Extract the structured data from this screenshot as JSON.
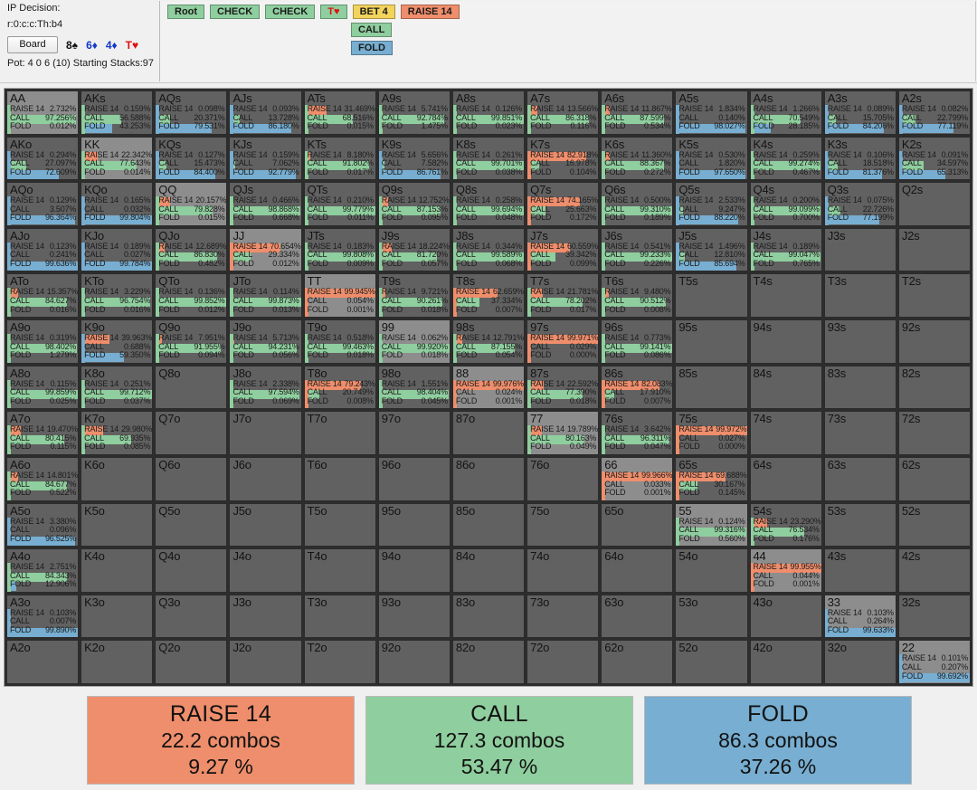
{
  "header": {
    "decision_label": "IP Decision:",
    "line_code": "r:0:c:c:Th:b4",
    "board_button": "Board",
    "board_cards": [
      {
        "text": "8♠",
        "color": "black"
      },
      {
        "text": "6♦",
        "color": "blue"
      },
      {
        "text": "4♦",
        "color": "blue"
      },
      {
        "text": "T♥",
        "color": "red"
      }
    ],
    "pot_line": "Pot: 4 0 6 (10) Starting Stacks:97",
    "tree_row1": [
      {
        "label": "Root",
        "style": "n-green"
      },
      {
        "label": "CHECK",
        "style": "n-green"
      },
      {
        "label": "CHECK",
        "style": "n-green"
      },
      {
        "label": "T♥",
        "style": "n-green",
        "red_suit": true
      },
      {
        "label": "BET 4",
        "style": "n-yellow"
      },
      {
        "label": "RAISE 14",
        "style": "n-orange"
      }
    ],
    "tree_row2": [
      {
        "label": "CALL",
        "style": "n-green"
      }
    ],
    "tree_row3": [
      {
        "label": "FOLD",
        "style": "n-blue"
      }
    ]
  },
  "colors": {
    "raise": "#ef8e6c",
    "call": "#8fce9e",
    "fold": "#77aed1",
    "cell_bg": "#616161",
    "pair_bg": "#8d8d8d"
  },
  "action_names": {
    "raise": "RAISE 14",
    "call": "CALL",
    "fold": "FOLD"
  },
  "summary": [
    {
      "title": "RAISE 14",
      "combos": "22.2 combos",
      "percent": "9.27 %",
      "style": "s-raise"
    },
    {
      "title": "CALL",
      "combos": "127.3 combos",
      "percent": "53.47 %",
      "style": "s-call"
    },
    {
      "title": "FOLD",
      "combos": "86.3 combos",
      "percent": "37.26 %",
      "style": "s-fold"
    }
  ],
  "chart_data": {
    "type": "heatmap",
    "title": "Poker hand range grid — IP decision r:0:c:c:Th:b4",
    "xlabel": "",
    "ylabel": "",
    "rows": 13,
    "cols": 13,
    "ranks": [
      "A",
      "K",
      "Q",
      "J",
      "T",
      "9",
      "8",
      "7",
      "6",
      "5",
      "4",
      "3",
      "2"
    ],
    "actions": [
      "RAISE 14",
      "CALL",
      "FOLD"
    ],
    "legend": [
      "RAISE 14 (orange)",
      "CALL (green)",
      "FOLD (blue)"
    ],
    "cells": [
      {
        "hand": "AA",
        "pair": true,
        "raise": 2.732,
        "call": 97.256,
        "fold": 0.012
      },
      {
        "hand": "AKs",
        "raise": 0.159,
        "call": 56.588,
        "fold": 43.253
      },
      {
        "hand": "AQs",
        "raise": 0.098,
        "call": 20.371,
        "fold": 79.531
      },
      {
        "hand": "AJs",
        "raise": 0.093,
        "call": 13.728,
        "fold": 86.18
      },
      {
        "hand": "ATs",
        "raise": 31.469,
        "call": 68.516,
        "fold": 0.015
      },
      {
        "hand": "A9s",
        "raise": 5.741,
        "call": 92.784,
        "fold": 1.475
      },
      {
        "hand": "A8s",
        "raise": 0.126,
        "call": 99.851,
        "fold": 0.023
      },
      {
        "hand": "A7s",
        "raise": 13.566,
        "call": 86.318,
        "fold": 0.116
      },
      {
        "hand": "A6s",
        "raise": 11.867,
        "call": 87.599,
        "fold": 0.534
      },
      {
        "hand": "A5s",
        "raise": 1.834,
        "call": 0.14,
        "fold": 98.027
      },
      {
        "hand": "A4s",
        "raise": 1.266,
        "call": 70.549,
        "fold": 28.185
      },
      {
        "hand": "A3s",
        "raise": 0.089,
        "call": 15.705,
        "fold": 84.206
      },
      {
        "hand": "A2s",
        "raise": 0.082,
        "call": 22.799,
        "fold": 77.119
      },
      {
        "hand": "AKo",
        "raise": 0.294,
        "call": 27.097,
        "fold": 72.609
      },
      {
        "hand": "KK",
        "pair": true,
        "raise": 22.342,
        "call": 77.643,
        "fold": 0.014
      },
      {
        "hand": "KQs",
        "raise": 0.127,
        "call": 15.473,
        "fold": 84.4
      },
      {
        "hand": "KJs",
        "raise": 0.159,
        "call": 7.062,
        "fold": 92.779
      },
      {
        "hand": "KTs",
        "raise": 8.18,
        "call": 91.802,
        "fold": 0.017
      },
      {
        "hand": "K9s",
        "raise": 5.656,
        "call": 7.582,
        "fold": 86.761
      },
      {
        "hand": "K8s",
        "raise": 0.261,
        "call": 99.701,
        "fold": 0.038
      },
      {
        "hand": "K7s",
        "raise": 82.918,
        "call": 16.978,
        "fold": 0.104
      },
      {
        "hand": "K6s",
        "raise": 11.36,
        "call": 88.367,
        "fold": 0.272
      },
      {
        "hand": "K5s",
        "raise": 0.53,
        "call": 1.82,
        "fold": 97.65
      },
      {
        "hand": "K4s",
        "raise": 0.259,
        "call": 99.274,
        "fold": 0.467
      },
      {
        "hand": "K3s",
        "raise": 0.106,
        "call": 18.518,
        "fold": 81.376
      },
      {
        "hand": "K2s",
        "raise": 0.091,
        "call": 34.597,
        "fold": 65.313
      },
      {
        "hand": "AQo",
        "raise": 0.129,
        "call": 3.507,
        "fold": 96.364
      },
      {
        "hand": "KQo",
        "raise": 0.165,
        "call": 0.032,
        "fold": 99.804
      },
      {
        "hand": "QQ",
        "pair": true,
        "raise": 20.157,
        "call": 79.828,
        "fold": 0.015
      },
      {
        "hand": "QJs",
        "raise": 0.466,
        "call": 98.868,
        "fold": 0.668
      },
      {
        "hand": "QTs",
        "raise": 0.21,
        "call": 99.779,
        "fold": 0.011
      },
      {
        "hand": "Q9s",
        "raise": 12.752,
        "call": 87.153,
        "fold": 0.095
      },
      {
        "hand": "Q8s",
        "raise": 0.258,
        "call": 99.694,
        "fold": 0.048
      },
      {
        "hand": "Q7s",
        "raise": 74.165,
        "call": 25.663,
        "fold": 0.172
      },
      {
        "hand": "Q6s",
        "raise": 0.5,
        "call": 99.31,
        "fold": 0.189
      },
      {
        "hand": "Q5s",
        "raise": 2.533,
        "call": 9.247,
        "fold": 88.22
      },
      {
        "hand": "Q4s",
        "raise": 0.2,
        "call": 99.099,
        "fold": 0.7
      },
      {
        "hand": "Q3s",
        "raise": 0.075,
        "call": 22.726,
        "fold": 77.199
      },
      {
        "hand": "Q2s",
        "empty": true
      },
      {
        "hand": "AJo",
        "raise": 0.123,
        "call": 0.241,
        "fold": 99.636
      },
      {
        "hand": "KJo",
        "raise": 0.189,
        "call": 0.027,
        "fold": 99.784
      },
      {
        "hand": "QJo",
        "raise": 12.689,
        "call": 86.83,
        "fold": 0.482
      },
      {
        "hand": "JJ",
        "pair": true,
        "raise": 70.654,
        "call": 29.334,
        "fold": 0.012
      },
      {
        "hand": "JTs",
        "raise": 0.183,
        "call": 99.808,
        "fold": 0.009
      },
      {
        "hand": "J9s",
        "raise": 18.224,
        "call": 81.72,
        "fold": 0.057
      },
      {
        "hand": "J8s",
        "raise": 0.344,
        "call": 99.589,
        "fold": 0.068
      },
      {
        "hand": "J7s",
        "raise": 60.559,
        "call": 39.342,
        "fold": 0.099
      },
      {
        "hand": "J6s",
        "raise": 0.541,
        "call": 99.233,
        "fold": 0.226
      },
      {
        "hand": "J5s",
        "raise": 1.496,
        "call": 12.81,
        "fold": 85.694
      },
      {
        "hand": "J4s",
        "raise": 0.189,
        "call": 99.047,
        "fold": 0.765
      },
      {
        "hand": "J3s",
        "empty": true
      },
      {
        "hand": "J2s",
        "empty": true
      },
      {
        "hand": "ATo",
        "raise": 15.357,
        "call": 84.627,
        "fold": 0.016
      },
      {
        "hand": "KTo",
        "raise": 3.229,
        "call": 96.754,
        "fold": 0.016
      },
      {
        "hand": "QTo",
        "raise": 0.136,
        "call": 99.852,
        "fold": 0.012
      },
      {
        "hand": "JTo",
        "raise": 0.114,
        "call": 99.873,
        "fold": 0.013
      },
      {
        "hand": "TT",
        "pair": true,
        "raise": 99.945,
        "call": 0.054,
        "fold": 0.001
      },
      {
        "hand": "T9s",
        "raise": 9.721,
        "call": 90.261,
        "fold": 0.018
      },
      {
        "hand": "T8s",
        "raise": 62.659,
        "call": 37.334,
        "fold": 0.007
      },
      {
        "hand": "T7s",
        "raise": 21.781,
        "call": 78.202,
        "fold": 0.017
      },
      {
        "hand": "T6s",
        "raise": 9.48,
        "call": 90.512,
        "fold": 0.008
      },
      {
        "hand": "T5s",
        "empty": true
      },
      {
        "hand": "T4s",
        "empty": true
      },
      {
        "hand": "T3s",
        "empty": true
      },
      {
        "hand": "T2s",
        "empty": true
      },
      {
        "hand": "A9o",
        "raise": 0.319,
        "call": 98.402,
        "fold": 1.279
      },
      {
        "hand": "K9o",
        "raise": 39.963,
        "call": 0.688,
        "fold": 59.35
      },
      {
        "hand": "Q9o",
        "raise": 7.951,
        "call": 91.955,
        "fold": 0.094
      },
      {
        "hand": "J9o",
        "raise": 5.713,
        "call": 94.231,
        "fold": 0.056
      },
      {
        "hand": "T9o",
        "raise": 0.518,
        "call": 99.463,
        "fold": 0.018
      },
      {
        "hand": "99",
        "pair": true,
        "raise": 0.062,
        "call": 99.92,
        "fold": 0.018
      },
      {
        "hand": "98s",
        "raise": 12.791,
        "call": 87.155,
        "fold": 0.054
      },
      {
        "hand": "97s",
        "raise": 99.971,
        "call": 0.029,
        "fold": 0.0
      },
      {
        "hand": "96s",
        "raise": 0.773,
        "call": 99.141,
        "fold": 0.086
      },
      {
        "hand": "95s",
        "empty": true
      },
      {
        "hand": "94s",
        "empty": true
      },
      {
        "hand": "93s",
        "empty": true
      },
      {
        "hand": "92s",
        "empty": true
      },
      {
        "hand": "A8o",
        "raise": 0.115,
        "call": 99.859,
        "fold": 0.025
      },
      {
        "hand": "K8o",
        "raise": 0.251,
        "call": 99.712,
        "fold": 0.037
      },
      {
        "hand": "Q8o",
        "empty": true
      },
      {
        "hand": "J8o",
        "raise": 2.338,
        "call": 97.594,
        "fold": 0.069
      },
      {
        "hand": "T8o",
        "raise": 79.243,
        "call": 20.749,
        "fold": 0.008
      },
      {
        "hand": "98o",
        "raise": 1.551,
        "call": 98.404,
        "fold": 0.045
      },
      {
        "hand": "88",
        "pair": true,
        "raise": 99.976,
        "call": 0.024,
        "fold": 0.001
      },
      {
        "hand": "87s",
        "raise": 22.592,
        "call": 77.39,
        "fold": 0.018
      },
      {
        "hand": "86s",
        "raise": 82.083,
        "call": 17.91,
        "fold": 0.007
      },
      {
        "hand": "85s",
        "empty": true
      },
      {
        "hand": "84s",
        "empty": true
      },
      {
        "hand": "83s",
        "empty": true
      },
      {
        "hand": "82s",
        "empty": true
      },
      {
        "hand": "A7o",
        "raise": 19.47,
        "call": 80.415,
        "fold": 0.115
      },
      {
        "hand": "K7o",
        "raise": 29.98,
        "call": 69.935,
        "fold": 0.085
      },
      {
        "hand": "Q7o",
        "empty": true
      },
      {
        "hand": "J7o",
        "empty": true
      },
      {
        "hand": "T7o",
        "empty": true
      },
      {
        "hand": "97o",
        "empty": true
      },
      {
        "hand": "87o",
        "empty": true
      },
      {
        "hand": "77",
        "pair": true,
        "raise": 19.789,
        "call": 80.163,
        "fold": 0.049
      },
      {
        "hand": "76s",
        "raise": 3.642,
        "call": 96.311,
        "fold": 0.047
      },
      {
        "hand": "75s",
        "raise": 99.972,
        "call": 0.027,
        "fold": 0.0
      },
      {
        "hand": "74s",
        "empty": true
      },
      {
        "hand": "73s",
        "empty": true
      },
      {
        "hand": "72s",
        "empty": true
      },
      {
        "hand": "A6o",
        "raise": 14.801,
        "call": 84.677,
        "fold": 0.522
      },
      {
        "hand": "K6o",
        "empty": true
      },
      {
        "hand": "Q6o",
        "empty": true
      },
      {
        "hand": "J6o",
        "empty": true
      },
      {
        "hand": "T6o",
        "empty": true
      },
      {
        "hand": "96o",
        "empty": true
      },
      {
        "hand": "86o",
        "empty": true
      },
      {
        "hand": "76o",
        "empty": true
      },
      {
        "hand": "66",
        "pair": true,
        "raise": 99.966,
        "call": 0.033,
        "fold": 0.001
      },
      {
        "hand": "65s",
        "raise": 69.688,
        "call": 30.167,
        "fold": 0.145
      },
      {
        "hand": "64s",
        "empty": true
      },
      {
        "hand": "63s",
        "empty": true
      },
      {
        "hand": "62s",
        "empty": true
      },
      {
        "hand": "A5o",
        "raise": 3.38,
        "call": 0.096,
        "fold": 96.525
      },
      {
        "hand": "K5o",
        "empty": true
      },
      {
        "hand": "Q5o",
        "empty": true
      },
      {
        "hand": "J5o",
        "empty": true
      },
      {
        "hand": "T5o",
        "empty": true
      },
      {
        "hand": "95o",
        "empty": true
      },
      {
        "hand": "85o",
        "empty": true
      },
      {
        "hand": "75o",
        "empty": true
      },
      {
        "hand": "65o",
        "empty": true
      },
      {
        "hand": "55",
        "pair": true,
        "raise": 0.124,
        "call": 99.316,
        "fold": 0.56
      },
      {
        "hand": "54s",
        "raise": 23.29,
        "call": 76.534,
        "fold": 0.176
      },
      {
        "hand": "53s",
        "empty": true
      },
      {
        "hand": "52s",
        "empty": true
      },
      {
        "hand": "A4o",
        "raise": 2.751,
        "call": 84.343,
        "fold": 12.906
      },
      {
        "hand": "K4o",
        "empty": true
      },
      {
        "hand": "Q4o",
        "empty": true
      },
      {
        "hand": "J4o",
        "empty": true
      },
      {
        "hand": "T4o",
        "empty": true
      },
      {
        "hand": "94o",
        "empty": true
      },
      {
        "hand": "84o",
        "empty": true
      },
      {
        "hand": "74o",
        "empty": true
      },
      {
        "hand": "64o",
        "empty": true
      },
      {
        "hand": "54o",
        "empty": true
      },
      {
        "hand": "44",
        "pair": true,
        "raise": 99.955,
        "call": 0.044,
        "fold": 0.001
      },
      {
        "hand": "43s",
        "empty": true
      },
      {
        "hand": "42s",
        "empty": true
      },
      {
        "hand": "A3o",
        "raise": 0.103,
        "call": 0.007,
        "fold": 99.89
      },
      {
        "hand": "K3o",
        "empty": true
      },
      {
        "hand": "Q3o",
        "empty": true
      },
      {
        "hand": "J3o",
        "empty": true
      },
      {
        "hand": "T3o",
        "empty": true
      },
      {
        "hand": "93o",
        "empty": true
      },
      {
        "hand": "83o",
        "empty": true
      },
      {
        "hand": "73o",
        "empty": true
      },
      {
        "hand": "63o",
        "empty": true
      },
      {
        "hand": "53o",
        "empty": true
      },
      {
        "hand": "43o",
        "empty": true
      },
      {
        "hand": "33",
        "pair": true,
        "raise": 0.103,
        "call": 0.264,
        "fold": 99.633
      },
      {
        "hand": "32s",
        "empty": true
      },
      {
        "hand": "A2o",
        "empty": true
      },
      {
        "hand": "K2o",
        "empty": true
      },
      {
        "hand": "Q2o",
        "empty": true
      },
      {
        "hand": "J2o",
        "empty": true
      },
      {
        "hand": "T2o",
        "empty": true
      },
      {
        "hand": "92o",
        "empty": true
      },
      {
        "hand": "82o",
        "empty": true
      },
      {
        "hand": "72o",
        "empty": true
      },
      {
        "hand": "62o",
        "empty": true
      },
      {
        "hand": "52o",
        "empty": true
      },
      {
        "hand": "42o",
        "empty": true
      },
      {
        "hand": "32o",
        "empty": true
      },
      {
        "hand": "22",
        "pair": true,
        "raise": 0.101,
        "call": 0.207,
        "fold": 99.692
      }
    ]
  }
}
